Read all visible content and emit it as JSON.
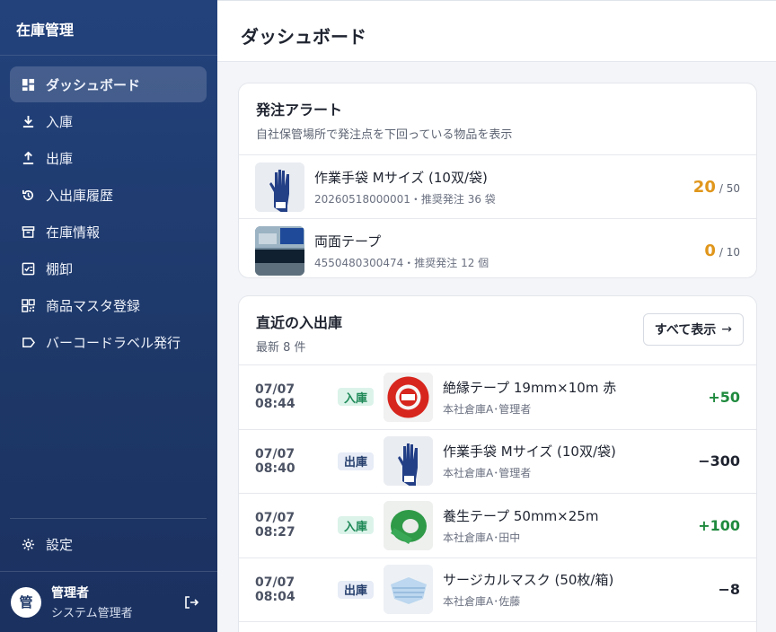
{
  "sidebar": {
    "brand": "在庫管理",
    "items": [
      {
        "label": "ダッシュボード",
        "icon": "dashboard-icon"
      },
      {
        "label": "入庫",
        "icon": "download-icon"
      },
      {
        "label": "出庫",
        "icon": "upload-icon"
      },
      {
        "label": "入出庫履歴",
        "icon": "history-icon"
      },
      {
        "label": "在庫情報",
        "icon": "archive-icon"
      },
      {
        "label": "棚卸",
        "icon": "checklist-icon"
      },
      {
        "label": "商品マスタ登録",
        "icon": "qr-code-icon"
      },
      {
        "label": "バーコードラベル発行",
        "icon": "label-icon"
      }
    ],
    "settings_label": "設定",
    "user": {
      "avatar_initial": "管",
      "name": "管理者",
      "role": "システム管理者"
    }
  },
  "header": {
    "title": "ダッシュボード"
  },
  "alerts": {
    "title": "発注アラート",
    "subtitle": "自社保管場所で発注点を下回っている物品を表示",
    "items": [
      {
        "name": "作業手袋 Mサイズ (10双/袋)",
        "meta": "20260518000001・推奨発注 36 袋",
        "current": "20",
        "threshold": "/ 50",
        "image": "gloves"
      },
      {
        "name": "両面テープ",
        "meta": "4550480300474・推奨発注 12 個",
        "current": "0",
        "threshold": "/ 10",
        "image": "tape-package"
      }
    ]
  },
  "recent": {
    "title": "直近の入出庫",
    "subtitle": "最新 8 件",
    "view_all_label": "すべて表示",
    "items": [
      {
        "time": "07/07 08:44",
        "type": "入庫",
        "kind": "in",
        "name": "絶縁テープ 19mm×10m 赤",
        "meta": "本社倉庫A･管理者",
        "qty": "+50",
        "image": "red-tape"
      },
      {
        "time": "07/07 08:40",
        "type": "出庫",
        "kind": "out",
        "name": "作業手袋 Mサイズ (10双/袋)",
        "meta": "本社倉庫A･管理者",
        "qty": "−300",
        "image": "gloves"
      },
      {
        "time": "07/07 08:27",
        "type": "入庫",
        "kind": "in",
        "name": "養生テープ 50mm×25m",
        "meta": "本社倉庫A･田中",
        "qty": "+100",
        "image": "green-tape"
      },
      {
        "time": "07/07 08:04",
        "type": "出庫",
        "kind": "out",
        "name": "サージカルマスク (50枚/箱)",
        "meta": "本社倉庫A･佐藤",
        "qty": "−8",
        "image": "masks"
      }
    ]
  },
  "colors": {
    "sidebar": "#1d3767",
    "warning": "#e0961b",
    "in_badge": "#dcf3ea",
    "out_badge": "#e7ecf6",
    "plus": "#1f8a3e"
  }
}
